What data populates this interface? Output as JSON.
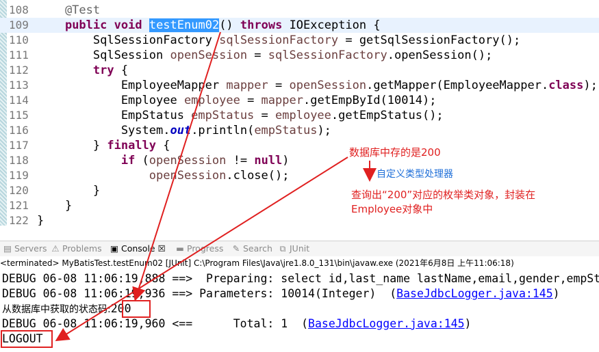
{
  "editor": {
    "lines": [
      {
        "num": "108",
        "text": "    @Test"
      },
      {
        "num": "109",
        "text": "    public void testEnum02() throws IOException {"
      },
      {
        "num": "110",
        "text": "        SqlSessionFactory sqlSessionFactory = getSqlSessionFactory();"
      },
      {
        "num": "111",
        "text": "        SqlSession openSession = sqlSessionFactory.openSession();"
      },
      {
        "num": "112",
        "text": "        try {"
      },
      {
        "num": "113",
        "text": "            EmployeeMapper mapper = openSession.getMapper(EmployeeMapper.class);"
      },
      {
        "num": "114",
        "text": "            Employee employee = mapper.getEmpById(10014);"
      },
      {
        "num": "115",
        "text": "            EmpStatus empStatus = employee.getEmpStatus();"
      },
      {
        "num": "116",
        "text": "            System.out.println(empStatus);"
      },
      {
        "num": "117",
        "text": "        } finally {"
      },
      {
        "num": "118",
        "text": "            if (openSession != null)"
      },
      {
        "num": "119",
        "text": "                openSession.close();"
      },
      {
        "num": "120",
        "text": "        }"
      },
      {
        "num": "121",
        "text": "    }"
      },
      {
        "num": "122",
        "text": "}"
      }
    ],
    "selected_word": "testEnum02"
  },
  "annotations": {
    "db_note": "数据库中存的是200",
    "handler_note": "自定义类型处理器",
    "query_note_1": "查询出“200”对应的枚举类对象，封装在",
    "query_note_2": "Employee对象中"
  },
  "views": {
    "tabs": [
      {
        "icon": "servers-icon",
        "label": "Servers"
      },
      {
        "icon": "problems-icon",
        "label": "Problems"
      },
      {
        "icon": "console-icon",
        "label": "Console",
        "active": true,
        "close": "☒"
      },
      {
        "icon": "progress-icon",
        "label": "Progress"
      },
      {
        "icon": "search-icon",
        "label": "Search"
      },
      {
        "icon": "junit-icon",
        "label": "JUnit"
      }
    ],
    "status": "<terminated> MyBatisTest.testEnum02 [JUnit] C:\\Program Files\\Java\\jre1.8.0_131\\bin\\javaw.exe (2021年6月8日 上午11:06:18)"
  },
  "console": {
    "l1": "DEBUG 06-08 11:06:19,888 ==>  Preparing: select id,last_name lastName,email,gender,empSt",
    "l2_text": "DEBUG 06-08 11:06:19,936 ==> Parameters: 10014(Integer)  (",
    "l2_link": "BaseJdbcLogger.java:145",
    "l2_end": ")",
    "l3_label": "从数据库中获取的状态码:",
    "l3_value": "200",
    "l4_text": "DEBUG 06-08 11:06:19,960 <==      Total: 1  (",
    "l4_link": "BaseJdbcLogger.java:145",
    "l4_end": ")",
    "l5": "LOGOUT"
  },
  "colors": {
    "annotation_red": "#e02020",
    "annotation_blue": "#1f6fd8",
    "link": "#0000ff",
    "keyword": "#7f0055"
  }
}
